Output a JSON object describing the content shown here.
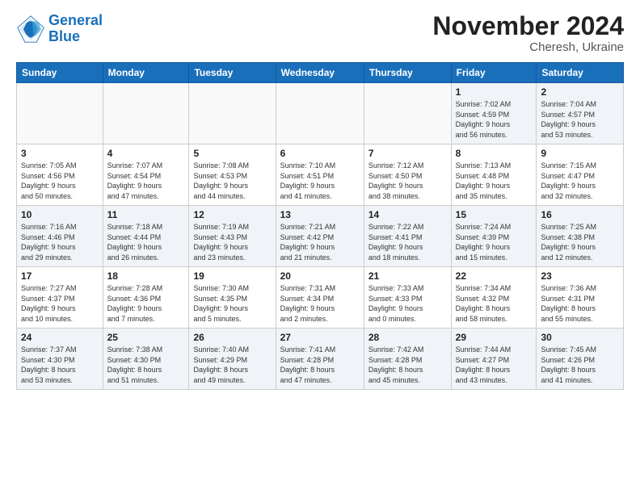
{
  "header": {
    "logo_line1": "General",
    "logo_line2": "Blue",
    "month_title": "November 2024",
    "location": "Cheresh, Ukraine"
  },
  "weekdays": [
    "Sunday",
    "Monday",
    "Tuesday",
    "Wednesday",
    "Thursday",
    "Friday",
    "Saturday"
  ],
  "weeks": [
    [
      {
        "day": "",
        "info": ""
      },
      {
        "day": "",
        "info": ""
      },
      {
        "day": "",
        "info": ""
      },
      {
        "day": "",
        "info": ""
      },
      {
        "day": "",
        "info": ""
      },
      {
        "day": "1",
        "info": "Sunrise: 7:02 AM\nSunset: 4:59 PM\nDaylight: 9 hours\nand 56 minutes."
      },
      {
        "day": "2",
        "info": "Sunrise: 7:04 AM\nSunset: 4:57 PM\nDaylight: 9 hours\nand 53 minutes."
      }
    ],
    [
      {
        "day": "3",
        "info": "Sunrise: 7:05 AM\nSunset: 4:56 PM\nDaylight: 9 hours\nand 50 minutes."
      },
      {
        "day": "4",
        "info": "Sunrise: 7:07 AM\nSunset: 4:54 PM\nDaylight: 9 hours\nand 47 minutes."
      },
      {
        "day": "5",
        "info": "Sunrise: 7:08 AM\nSunset: 4:53 PM\nDaylight: 9 hours\nand 44 minutes."
      },
      {
        "day": "6",
        "info": "Sunrise: 7:10 AM\nSunset: 4:51 PM\nDaylight: 9 hours\nand 41 minutes."
      },
      {
        "day": "7",
        "info": "Sunrise: 7:12 AM\nSunset: 4:50 PM\nDaylight: 9 hours\nand 38 minutes."
      },
      {
        "day": "8",
        "info": "Sunrise: 7:13 AM\nSunset: 4:48 PM\nDaylight: 9 hours\nand 35 minutes."
      },
      {
        "day": "9",
        "info": "Sunrise: 7:15 AM\nSunset: 4:47 PM\nDaylight: 9 hours\nand 32 minutes."
      }
    ],
    [
      {
        "day": "10",
        "info": "Sunrise: 7:16 AM\nSunset: 4:46 PM\nDaylight: 9 hours\nand 29 minutes."
      },
      {
        "day": "11",
        "info": "Sunrise: 7:18 AM\nSunset: 4:44 PM\nDaylight: 9 hours\nand 26 minutes."
      },
      {
        "day": "12",
        "info": "Sunrise: 7:19 AM\nSunset: 4:43 PM\nDaylight: 9 hours\nand 23 minutes."
      },
      {
        "day": "13",
        "info": "Sunrise: 7:21 AM\nSunset: 4:42 PM\nDaylight: 9 hours\nand 21 minutes."
      },
      {
        "day": "14",
        "info": "Sunrise: 7:22 AM\nSunset: 4:41 PM\nDaylight: 9 hours\nand 18 minutes."
      },
      {
        "day": "15",
        "info": "Sunrise: 7:24 AM\nSunset: 4:39 PM\nDaylight: 9 hours\nand 15 minutes."
      },
      {
        "day": "16",
        "info": "Sunrise: 7:25 AM\nSunset: 4:38 PM\nDaylight: 9 hours\nand 12 minutes."
      }
    ],
    [
      {
        "day": "17",
        "info": "Sunrise: 7:27 AM\nSunset: 4:37 PM\nDaylight: 9 hours\nand 10 minutes."
      },
      {
        "day": "18",
        "info": "Sunrise: 7:28 AM\nSunset: 4:36 PM\nDaylight: 9 hours\nand 7 minutes."
      },
      {
        "day": "19",
        "info": "Sunrise: 7:30 AM\nSunset: 4:35 PM\nDaylight: 9 hours\nand 5 minutes."
      },
      {
        "day": "20",
        "info": "Sunrise: 7:31 AM\nSunset: 4:34 PM\nDaylight: 9 hours\nand 2 minutes."
      },
      {
        "day": "21",
        "info": "Sunrise: 7:33 AM\nSunset: 4:33 PM\nDaylight: 9 hours\nand 0 minutes."
      },
      {
        "day": "22",
        "info": "Sunrise: 7:34 AM\nSunset: 4:32 PM\nDaylight: 8 hours\nand 58 minutes."
      },
      {
        "day": "23",
        "info": "Sunrise: 7:36 AM\nSunset: 4:31 PM\nDaylight: 8 hours\nand 55 minutes."
      }
    ],
    [
      {
        "day": "24",
        "info": "Sunrise: 7:37 AM\nSunset: 4:30 PM\nDaylight: 8 hours\nand 53 minutes."
      },
      {
        "day": "25",
        "info": "Sunrise: 7:38 AM\nSunset: 4:30 PM\nDaylight: 8 hours\nand 51 minutes."
      },
      {
        "day": "26",
        "info": "Sunrise: 7:40 AM\nSunset: 4:29 PM\nDaylight: 8 hours\nand 49 minutes."
      },
      {
        "day": "27",
        "info": "Sunrise: 7:41 AM\nSunset: 4:28 PM\nDaylight: 8 hours\nand 47 minutes."
      },
      {
        "day": "28",
        "info": "Sunrise: 7:42 AM\nSunset: 4:28 PM\nDaylight: 8 hours\nand 45 minutes."
      },
      {
        "day": "29",
        "info": "Sunrise: 7:44 AM\nSunset: 4:27 PM\nDaylight: 8 hours\nand 43 minutes."
      },
      {
        "day": "30",
        "info": "Sunrise: 7:45 AM\nSunset: 4:26 PM\nDaylight: 8 hours\nand 41 minutes."
      }
    ]
  ]
}
